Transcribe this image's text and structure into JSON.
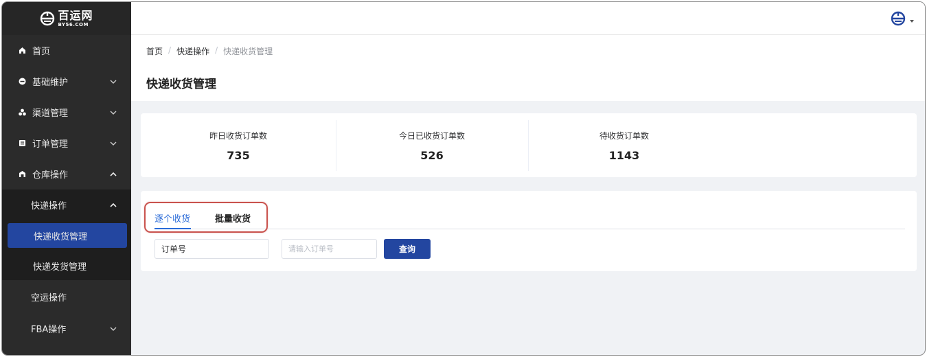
{
  "logo": {
    "cn": "百运网",
    "en": "BY56.COM"
  },
  "sidebar": {
    "items": [
      {
        "label": "首页",
        "icon": "home-icon"
      },
      {
        "label": "基础维护",
        "icon": "circle-minus-icon"
      },
      {
        "label": "渠道管理",
        "icon": "cluster-icon"
      },
      {
        "label": "订单管理",
        "icon": "list-icon"
      },
      {
        "label": "仓库操作",
        "icon": "warehouse-icon"
      }
    ],
    "warehouse_sub": {
      "express_ops": "快递操作",
      "express_receive": "快递收货管理",
      "express_ship": "快递发货管理",
      "air_ops": "空运操作",
      "fba_ops": "FBA操作"
    }
  },
  "breadcrumb": {
    "home": "首页",
    "sep": "/",
    "mid": "快递操作",
    "current": "快递收货管理"
  },
  "page_title": "快递收货管理",
  "stats": [
    {
      "label": "昨日收货订单数",
      "value": "735"
    },
    {
      "label": "今日已收货订单数",
      "value": "526"
    },
    {
      "label": "待收货订单数",
      "value": "1143"
    }
  ],
  "tabs": {
    "single": "逐个收货",
    "batch": "批量收货"
  },
  "search": {
    "type_value": "订单号",
    "placeholder": "请输入订单号",
    "query_label": "查询"
  },
  "colors": {
    "sidebar_bg": "#2b2b2b",
    "accent": "#2346a0",
    "tab_active": "#2a6bd8",
    "highlight": "#c9524d"
  }
}
